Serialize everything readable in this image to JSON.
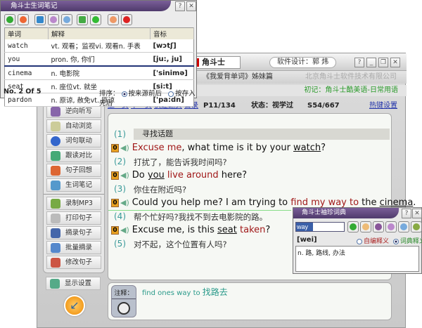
{
  "main_window": {
    "logo_text": "角斗士",
    "designer": "软件设计：郭 炜",
    "buttons": [
      "?",
      "_",
      "❐",
      "✕"
    ],
    "subtitle": "《我爱背单词》姊妹篇",
    "company": "北京角斗士软件技术有限公司",
    "course": "初记：角斗士酷美语-日常用语",
    "nav": {
      "prev": "上一页",
      "next": "下一页",
      "quick": "快速翻页",
      "toc": "目录",
      "page": "P11/134",
      "status": "状态：视学过",
      "sentence": "S54/667",
      "hotkeys": "热键设置"
    },
    "sidebar": {
      "group1": [
        "逆向听写",
        "自动浏览",
        "词句联动",
        "跟读对比",
        "句子回想",
        "生词笔记"
      ],
      "group2": [
        "录制MP3",
        "打印句子",
        "摘录句子",
        "批量摘录",
        "修改句子"
      ],
      "display": "显示设置"
    },
    "entries": [
      {
        "num": "(1)",
        "title": "寻找话题",
        "badge": "0",
        "en": [
          [
            "Excuse me",
            "red"
          ],
          [
            ", what time is it by your ",
            ""
          ],
          [
            "watch",
            "u"
          ],
          [
            "?",
            ""
          ]
        ]
      },
      {
        "num": "(2)",
        "zh": "打扰了，能告诉我时间吗?",
        "badge": "0",
        "en": [
          [
            "Do ",
            ""
          ],
          [
            "you",
            "u"
          ],
          [
            " ",
            ""
          ],
          [
            "live around",
            "red"
          ],
          [
            " here?",
            ""
          ]
        ]
      },
      {
        "num": "(3)",
        "zh": "你住在附近吗?",
        "badge": "0",
        "en": [
          [
            "Could you help me? I am trying to ",
            ""
          ],
          [
            "find my way to",
            "red"
          ],
          [
            " the ",
            ""
          ],
          [
            "cinema",
            "u"
          ],
          [
            ".",
            ""
          ]
        ]
      },
      {
        "num": "(4)",
        "zh": "帮个忙好吗?我找不到去电影院的路。",
        "badge": "0",
        "en": [
          [
            "Excuse me, is this ",
            ""
          ],
          [
            "seat",
            "u"
          ],
          [
            " ",
            ""
          ],
          [
            "taken",
            "red"
          ],
          [
            "?",
            ""
          ]
        ]
      },
      {
        "num": "(5)",
        "zh": "对不起，这个位置有人吗?"
      }
    ],
    "notes": {
      "label": "注释：",
      "text_en": "find ones way to ",
      "text_zh": "找路去"
    }
  },
  "vocab_window": {
    "title": "角斗士生词笔记",
    "columns": [
      "单词",
      "解释",
      "音标"
    ],
    "rows": [
      {
        "word": "watch",
        "meaning": "vt. 观看；监视vi. 观看n. 手表",
        "phonetic": "[wɔtʃ]"
      },
      {
        "word": "you",
        "meaning": "pron. 你, 你们",
        "phonetic": "[ju:, ju]"
      },
      {
        "word": "cinema",
        "meaning": "n. 电影院",
        "phonetic": "['sinimə]"
      },
      {
        "word": "seat",
        "meaning": "n. 座位vt. 就坐",
        "phonetic": "[si:t]"
      },
      {
        "word": "pardon",
        "meaning": "n. 原谅, 赦免vt. 原谅",
        "phonetic": "['pa:dn]"
      }
    ],
    "position": "No. 2 Of 5",
    "sort_label": "排序：",
    "sort_options": [
      "按来源前后",
      "按存入先后"
    ],
    "sort_selected": 0
  },
  "dict_window": {
    "title": "角斗士袖珍词典",
    "query": "way",
    "phonetic": "[wei]",
    "options": [
      "自编释义",
      "词典释义"
    ],
    "selected": 1,
    "definition": "n. 路, 路线, 办法"
  },
  "colors": {
    "accent_purple": "#5a4478",
    "keyword_red": "#a01818",
    "green": "#2a9a2a",
    "link": "#2233aa"
  }
}
